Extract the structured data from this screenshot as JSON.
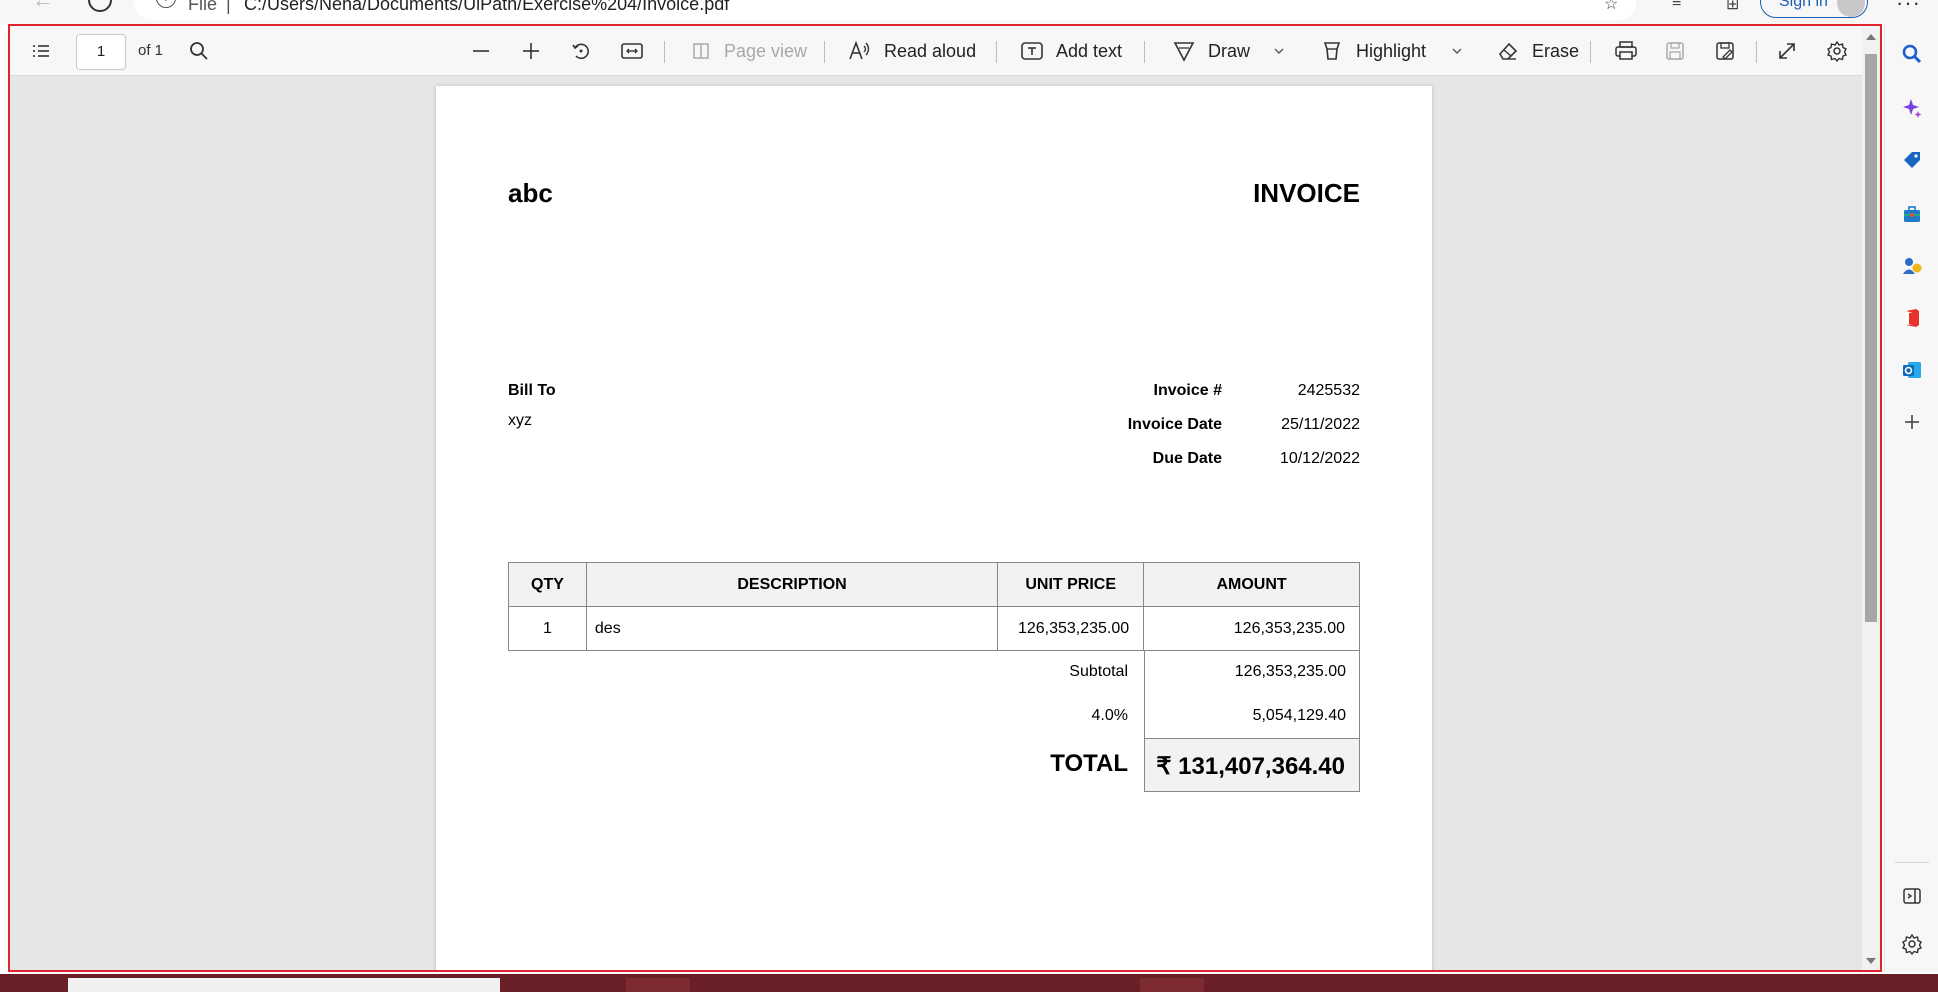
{
  "browser": {
    "file_label": "File",
    "separator": "|",
    "url": "C:/Users/Neha/Documents/UiPath/Exercise%204/Invoice.pdf",
    "signin_label": "Sign in"
  },
  "toolbar": {
    "page_current": "1",
    "page_total": "of 1",
    "page_view_label": "Page view",
    "read_aloud_label": "Read aloud",
    "add_text_label": "Add text",
    "draw_label": "Draw",
    "highlight_label": "Highlight",
    "erase_label": "Erase"
  },
  "invoice": {
    "company": "abc",
    "title": "INVOICE",
    "bill_to_label": "Bill To",
    "bill_to_name": "xyz",
    "meta": [
      {
        "label": "Invoice #",
        "value": "2425532"
      },
      {
        "label": "Invoice Date",
        "value": "25/11/2022"
      },
      {
        "label": "Due Date",
        "value": "10/12/2022"
      }
    ],
    "columns": [
      "QTY",
      "DESCRIPTION",
      "UNIT PRICE",
      "AMOUNT"
    ],
    "rows": [
      {
        "qty": "1",
        "description": "des",
        "unit_price": "126,353,235.00",
        "amount": "126,353,235.00"
      }
    ],
    "subtotal_label": "Subtotal",
    "subtotal_value": "126,353,235.00",
    "tax_label": "4.0%",
    "tax_value": "5,054,129.40",
    "total_label": "TOTAL",
    "total_value": "₹ 131,407,364.40"
  },
  "colors": {
    "viewer_border": "#e0242c",
    "signin_accent": "#1a5fb4"
  },
  "sidebar_icons": [
    "search-icon",
    "copilot-icon",
    "shopping-tag-icon",
    "tools-icon",
    "games-icon",
    "office-icon",
    "outlook-icon",
    "add-icon",
    "hide-sidebar-icon",
    "sidebar-settings-icon"
  ]
}
